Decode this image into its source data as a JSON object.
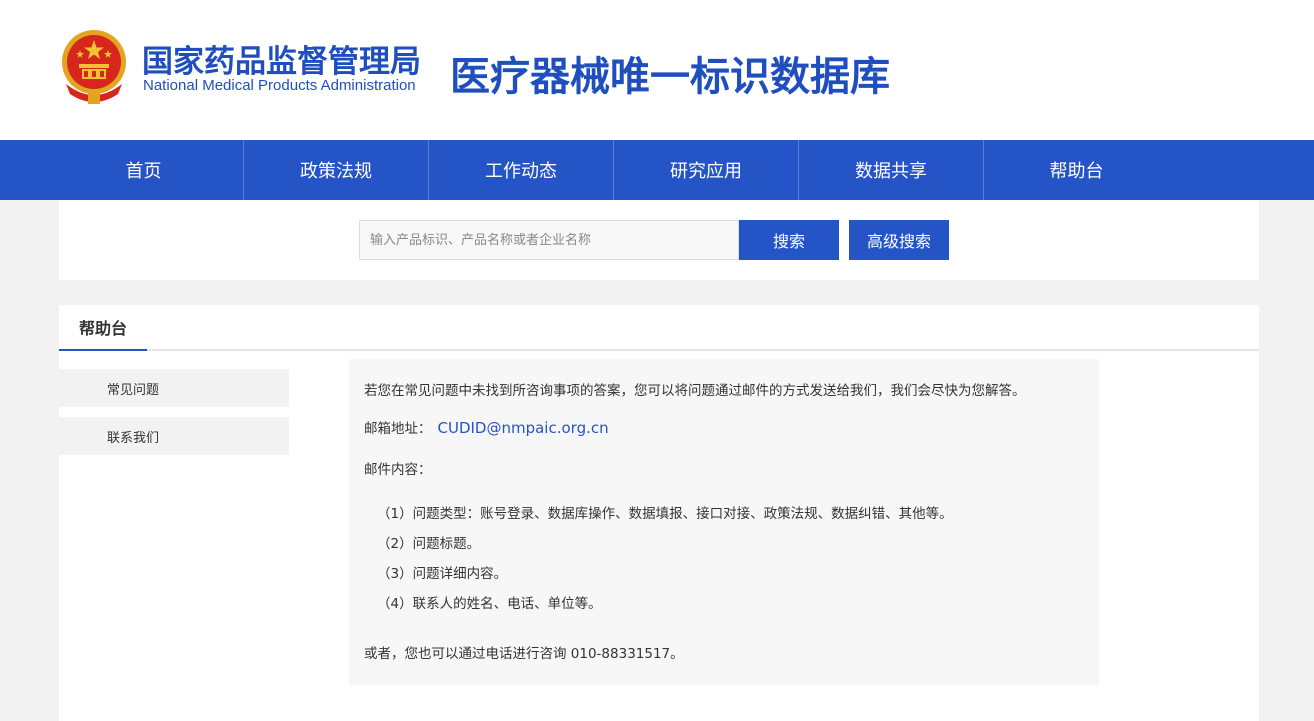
{
  "header": {
    "agency_cn": "国家药品监督管理局",
    "agency_en": "National Medical Products  Administration",
    "db_title": "医疗器械唯一标识数据库",
    "emblem_icon": "national-emblem-icon"
  },
  "nav": {
    "items": [
      "首页",
      "政策法规",
      "工作动态",
      "研究应用",
      "数据共享",
      "帮助台"
    ]
  },
  "search": {
    "placeholder": "输入产品标识、产品名称或者企业名称",
    "value": "",
    "search_label": "搜索",
    "advanced_label": "高级搜索"
  },
  "main": {
    "tab": "帮助台",
    "sidebar": [
      "常见问题",
      "联系我们"
    ],
    "content": {
      "intro": "若您在常见问题中未找到所咨询事项的答案，您可以将问题通过邮件的方式发送给我们，我们会尽快为您解答。",
      "email_label": "邮箱地址：",
      "email": "CUDID@nmpaic.org.cn",
      "content_label": "邮件内容：",
      "items": [
        "（1）问题类型：账号登录、数据库操作、数据填报、接口对接、政策法规、数据纠错、其他等。",
        "（2）问题标题。",
        "（3）问题详细内容。",
        "（4）联系人的姓名、电话、单位等。"
      ],
      "phone_note": "或者，您也可以通过电话进行咨询 010-88331517。"
    }
  },
  "colors": {
    "brand_blue": "#2554c7",
    "title_blue": "#1f4fbf",
    "emblem_red": "#d7261d",
    "emblem_gold": "#f4c430"
  }
}
